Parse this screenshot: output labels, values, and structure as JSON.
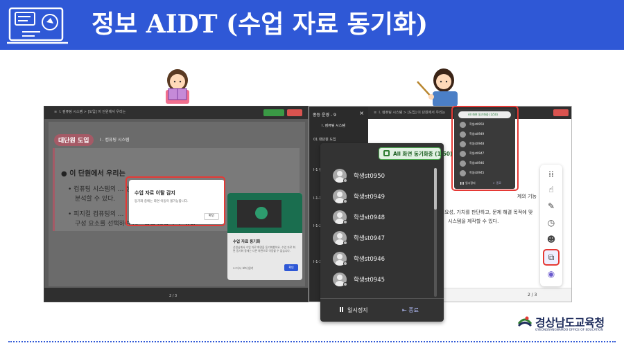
{
  "header": {
    "title": "정보 AIDT (수업 자료 동기화)",
    "bg_color": "#2f58d6"
  },
  "left_screen": {
    "unit_tag": "대단원 도입",
    "unit_sub": "I . 컴퓨팅 시스템",
    "section_title": "● 이 단원에서 우리는",
    "bullet1": "• 컴퓨팅 시스템의 ... 성, 해결 가능을",
    "bullet1b": "분석할 수 있다.",
    "bullet2": "• 피지컬 컴퓨팅의 ...",
    "bullet2b": "구성 요소를 선택하여 시스템을 제작할 수 있다.",
    "pager": "2 / 3",
    "dialog": {
      "title": "수업 자료 이탈 감지",
      "desc": "동기화 중에는 화면 이동이 불가능합니다.",
      "ok": "확인"
    },
    "sync_panel": {
      "title": "수업 자료 동기화",
      "desc": "선생님께서 수업 자료 화면을 동기화했어요. 수업 자료 화면 동기화 중에는 다른 화면으로 이동할 수 없습니다.",
      "checkbox": "다시 보지 않기",
      "ok": "확인"
    }
  },
  "right_screen": {
    "sidebar_title": "종등 운영 - 9",
    "sidebar_unit": "I. 컴퓨팅 시스템",
    "sidebar_items": [
      "01 대단원 도입",
      "I-1 컴퓨...",
      "I-1-1 ...",
      "I-1-2 ...",
      "I-1-3 ..."
    ],
    "body1": "제의 기능",
    "body2": "과 필요성, 가치를 판단하고, 문제 해결 목적에 맞",
    "body3": "시스템을 제작할 수 있다.",
    "pager": "2 / 3",
    "mini_list": {
      "header": "All 화면 동기화중 (1/50)",
      "students": [
        "학생st0950",
        "학생st0949",
        "학생st0948",
        "학생st0947",
        "학생st0946",
        "학생st0945"
      ],
      "pause": "일시정지",
      "end": "종료"
    }
  },
  "student_list": {
    "header": "All 화면 동기화중 (1/50)",
    "students": [
      "학생st0950",
      "학생st0949",
      "학생st0948",
      "학생st0947",
      "학생st0946",
      "학생st0945"
    ],
    "pause_label": "일시정지",
    "end_label": "종료"
  },
  "toolbar": {
    "tools": [
      "apps-icon",
      "pointer-icon",
      "pen-icon",
      "timer-icon",
      "group-icon",
      "sync-screen-icon",
      "ai-icon"
    ],
    "active": "sync-screen-icon"
  },
  "logo": {
    "main": "경상남도교육청",
    "sub": "GYEONGSANGNAMDO OFFICE OF EDUCATION"
  }
}
